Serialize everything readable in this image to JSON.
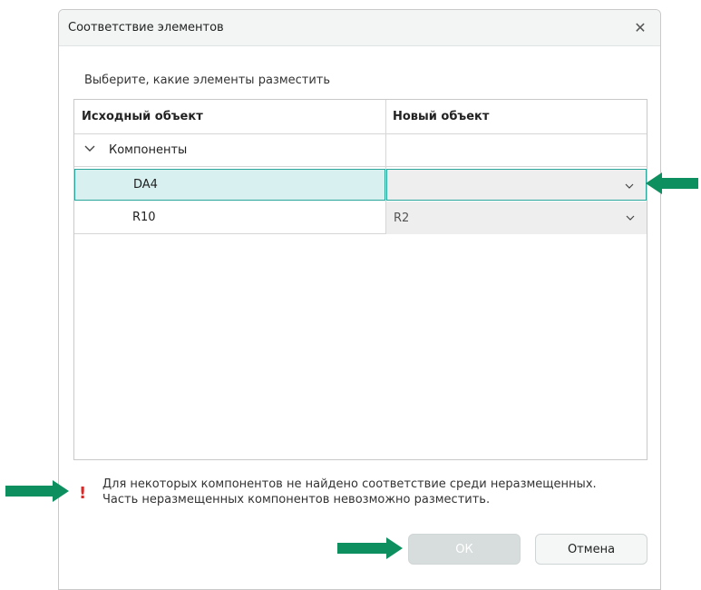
{
  "dialog": {
    "title": "Соответствие элементов",
    "close_icon": "close-icon",
    "subtitle": "Выберите, какие элементы разместить"
  },
  "grid": {
    "headers": [
      "Исходный объект",
      "Новый объект"
    ],
    "group": {
      "label": "Компоненты",
      "expanded": true
    },
    "rows": [
      {
        "source": "DA4",
        "target": "",
        "selected": true
      },
      {
        "source": "R10",
        "target": "R2",
        "selected": false
      }
    ]
  },
  "warning": {
    "icon": "exclamation-icon",
    "line1": "Для некоторых компонентов не найдено соответствие среди неразмещенных.",
    "line2": "Часть неразмещенных компонентов невозможно разместить."
  },
  "buttons": {
    "ok_label": "ОК",
    "ok_enabled": false,
    "cancel_label": "Отмена"
  },
  "colors": {
    "accent": "#2aa79a",
    "selected_row_bg": "#d8f0f0",
    "warning": "#d62b2b",
    "annotation_arrow": "#0e8f5f"
  }
}
